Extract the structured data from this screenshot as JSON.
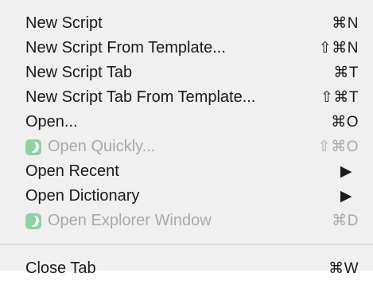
{
  "menu": {
    "items": [
      {
        "label": "New Script",
        "shortcut": "⌘N"
      },
      {
        "label": "New Script From Template...",
        "shortcut": "⇧⌘N"
      },
      {
        "label": "New Script Tab",
        "shortcut": "⌘T"
      },
      {
        "label": "New Script Tab From Template...",
        "shortcut": "⇧⌘T"
      },
      {
        "label": "Open...",
        "shortcut": "⌘O"
      },
      {
        "label": "Open Quickly...",
        "shortcut": "⇧⌘O"
      },
      {
        "label": "Open Recent",
        "shortcut": "▶"
      },
      {
        "label": "Open Dictionary",
        "shortcut": "▶"
      },
      {
        "label": "Open Explorer Window",
        "shortcut": "⌘D"
      },
      {
        "label": "Close Tab",
        "shortcut": "⌘W"
      }
    ],
    "icons": {
      "app_icon": "script-editor-app-icon",
      "submenu": "chevron-right-icon"
    },
    "colors": {
      "background": "#f0f0f0",
      "text": "#1a1a1a",
      "disabled_text": "#a8a8a8",
      "separator": "#dadada",
      "icon_green": "#8fd1a5"
    }
  }
}
